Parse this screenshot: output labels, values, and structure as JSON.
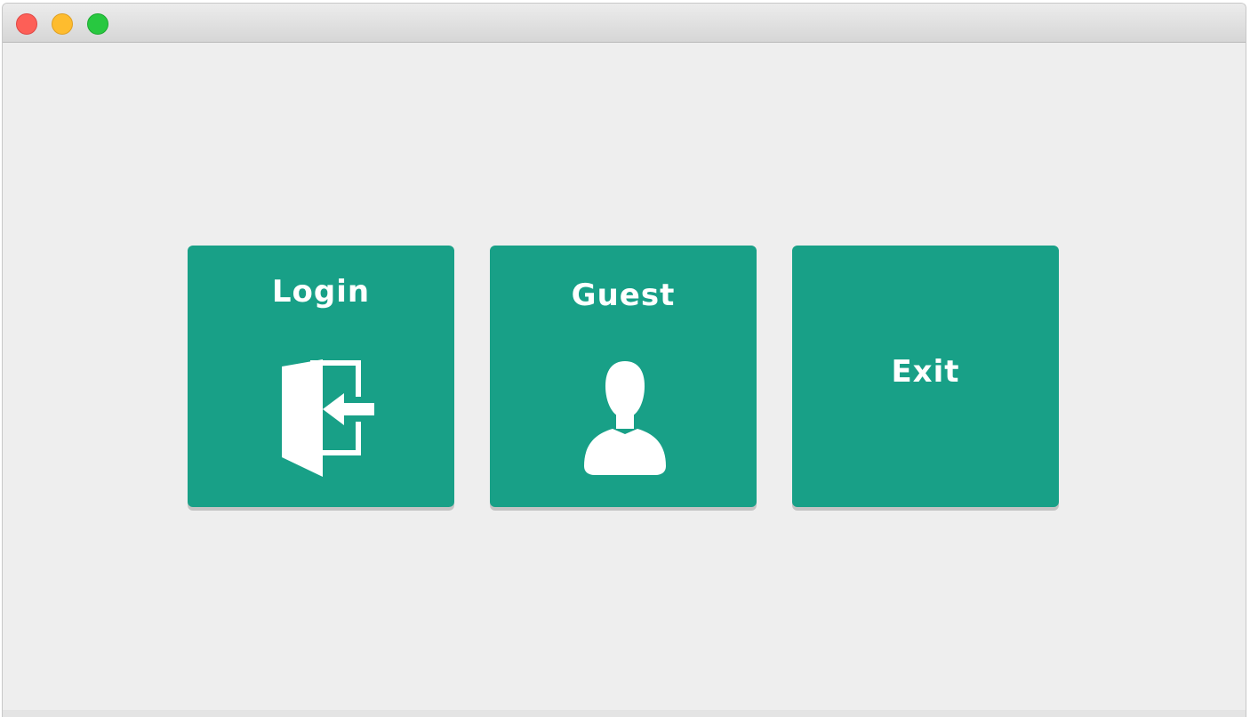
{
  "window": {
    "controls": {
      "close": "close",
      "minimize": "minimize",
      "zoom": "zoom"
    }
  },
  "menu": {
    "tiles": [
      {
        "label": "Login",
        "icon": "login-door-icon"
      },
      {
        "label": "Guest",
        "icon": "user-silhouette-icon"
      },
      {
        "label": "Exit",
        "icon": ""
      }
    ]
  },
  "colors": {
    "tile": "#18a087",
    "window_bg": "#eeeeee",
    "close": "#fd5f57",
    "minimize": "#febc2e",
    "zoom": "#28c840"
  }
}
